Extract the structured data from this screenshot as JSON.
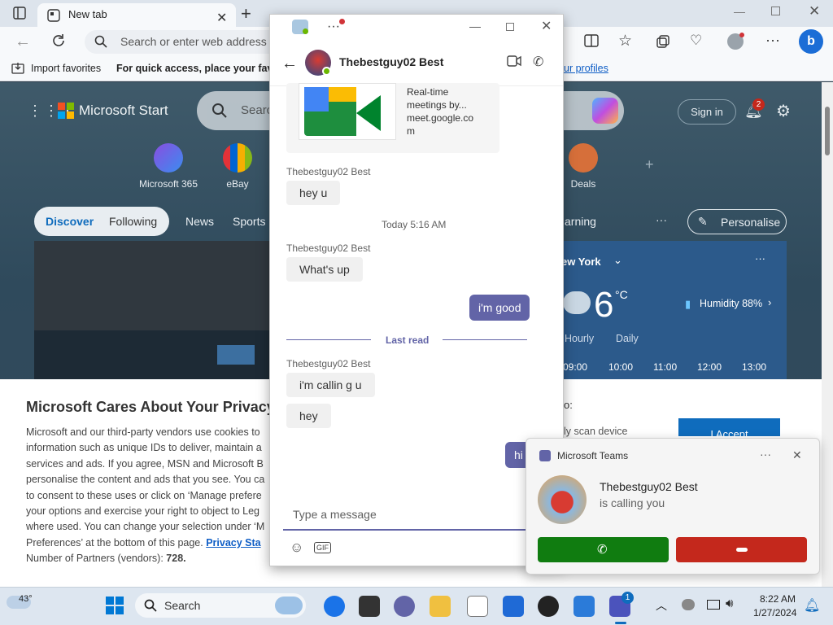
{
  "browser": {
    "tab_title": "New tab",
    "address_placeholder": "Search or enter web address",
    "favorites": {
      "import_label": "Import favorites",
      "hint": "For quick access, place your favorit",
      "profiles_link": "ur profiles"
    }
  },
  "msn": {
    "brand": "Microsoft Start",
    "search_placeholder": "Searc",
    "sign_in": "Sign in",
    "notification_count": "2",
    "shortcuts": [
      "Microsoft 365",
      "eBay",
      "Deals"
    ],
    "nav": [
      "Discover",
      "Following",
      "News",
      "Sports",
      "arning"
    ],
    "personalise": "Personalise",
    "weather": {
      "city": "ew York",
      "temp": "6",
      "unit": "°C",
      "humidity": "Humidity 88%",
      "tabs": [
        "Hourly",
        "Daily"
      ],
      "hours": [
        "09:00",
        "10:00",
        "11:00",
        "12:00",
        "13:00"
      ]
    }
  },
  "privacy": {
    "title": "Microsoft Cares About Your Privacy",
    "lines": [
      "Microsoft and our third-party vendors use cookies to",
      "information such as unique IDs to deliver, maintain a",
      "services and ads. If you agree, MSN and Microsoft B",
      "personalise the content and ads that you see. You ca",
      "to consent to these uses or click on ‘Manage prefere",
      "your options and exercise your right to object to Leg",
      "where used.  You can change your selection under ‘M",
      "Preferences’ at the bottom of this page."
    ],
    "privacy_link": "Privacy Sta",
    "partners_label": "Number of Partners (vendors):",
    "partners_count": "728",
    "right_snippet_1": "o:",
    "right_snippet_2": "ly scan device",
    "accept_label": "I Accept"
  },
  "chat": {
    "contact": "Thebestguy02 Best",
    "link_preview": {
      "line1": "Real-time",
      "line2": "meetings by...",
      "line3": "meet.google.co",
      "line4": "m"
    },
    "messages": [
      {
        "sender": "Thebestguy02 Best",
        "text": "hey u"
      },
      {
        "divider": "Today 5:16 AM"
      },
      {
        "sender": "Thebestguy02 Best",
        "text": "What's up"
      },
      {
        "me": "i'm good"
      },
      {
        "divider": "Last read"
      },
      {
        "sender": "Thebestguy02 Best",
        "text": "i'm callin g u"
      },
      {
        "text": "hey"
      },
      {
        "me": "hi"
      }
    ],
    "compose_placeholder": "Type a message",
    "gif_label": "GIF"
  },
  "toast": {
    "app": "Microsoft Teams",
    "caller": "Thebestguy02 Best",
    "status": "is calling you"
  },
  "taskbar": {
    "weather_temp": "43°",
    "search_label": "Search",
    "teams_badge": "1",
    "time": "8:22 AM",
    "date": "1/27/2024"
  },
  "colors": {
    "teams_purple": "#6264a7",
    "accept_green": "#107c10",
    "decline_red": "#c4281c",
    "edge_blue": "#0f6cbd"
  }
}
